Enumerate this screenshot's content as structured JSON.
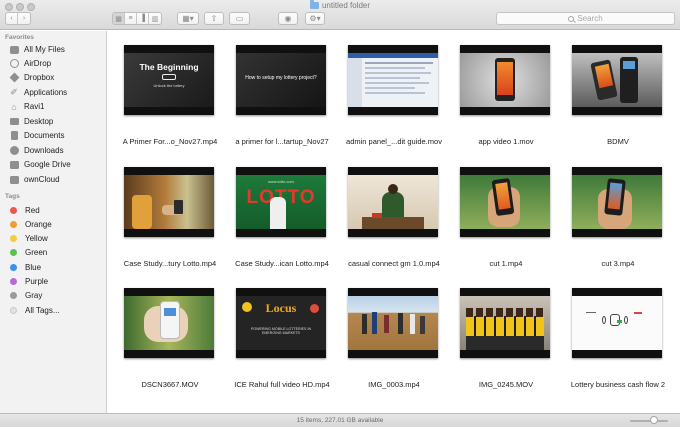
{
  "window": {
    "title": "untitled folder"
  },
  "toolbar": {
    "back_icon": "chevron-left-icon",
    "forward_icon": "chevron-right-icon",
    "search_placeholder": "Search"
  },
  "sidebar": {
    "favorites_heading": "Favorites",
    "favorites": [
      {
        "label": "All My Files",
        "icon": "all-files-icon"
      },
      {
        "label": "AirDrop",
        "icon": "airdrop-icon"
      },
      {
        "label": "Dropbox",
        "icon": "dropbox-icon"
      },
      {
        "label": "Applications",
        "icon": "applications-icon"
      },
      {
        "label": "Ravi1",
        "icon": "home-icon"
      },
      {
        "label": "Desktop",
        "icon": "desktop-icon"
      },
      {
        "label": "Documents",
        "icon": "documents-icon"
      },
      {
        "label": "Downloads",
        "icon": "downloads-icon"
      },
      {
        "label": "Google Drive",
        "icon": "folder-icon"
      },
      {
        "label": "ownCloud",
        "icon": "folder-icon"
      }
    ],
    "tags_heading": "Tags",
    "tags": [
      {
        "label": "Red",
        "color": "#f0554a"
      },
      {
        "label": "Orange",
        "color": "#f39b33"
      },
      {
        "label": "Yellow",
        "color": "#f4cd38"
      },
      {
        "label": "Green",
        "color": "#5ac24e"
      },
      {
        "label": "Blue",
        "color": "#3c8ef0"
      },
      {
        "label": "Purple",
        "color": "#b86bd6"
      },
      {
        "label": "Gray",
        "color": "#9a9a9a"
      },
      {
        "label": "All Tags...",
        "color": "#e2e2e2"
      }
    ]
  },
  "files": [
    {
      "label": "A Primer For...o_Nov27.mp4",
      "art": "begin",
      "title_text": "The Beginning",
      "sub_text": "Unlock the lottery"
    },
    {
      "label": "a primer for l...tartup_Nov27",
      "art": "setup",
      "title_text": "How to setup my lottery project?"
    },
    {
      "label": "admin panel_...dit guide.mov",
      "art": "screen"
    },
    {
      "label": "app video 1.mov",
      "art": "phone"
    },
    {
      "label": "BDMV",
      "art": "terminal"
    },
    {
      "label": "Case Study...tury Lotto.mp4",
      "art": "hands"
    },
    {
      "label": "Case Study...ican Lotto.mp4",
      "art": "lotto",
      "title_text": "LOTTO",
      "sub_text": "www.lotto.com"
    },
    {
      "label": "casual connect gm 1.0.mp4",
      "art": "man"
    },
    {
      "label": "cut 1.mp4",
      "art": "hand-phone"
    },
    {
      "label": "cut 3.mp4",
      "art": "hand-phone"
    },
    {
      "label": "DSCN3667.MOV",
      "art": "device"
    },
    {
      "label": "ICE Rahul full video HD.mp4",
      "art": "locus",
      "title_text": "Locus",
      "sub_text": "POWERING MOBILE LOTTERIES IN EMERGING MARKETS"
    },
    {
      "label": "IMG_0003.mp4",
      "art": "field"
    },
    {
      "label": "IMG_0245.MOV",
      "art": "group"
    },
    {
      "label": "Lottery business cash flow 2",
      "art": "sketch"
    }
  ],
  "status": {
    "text": "15 items, 227.01 GB available"
  }
}
